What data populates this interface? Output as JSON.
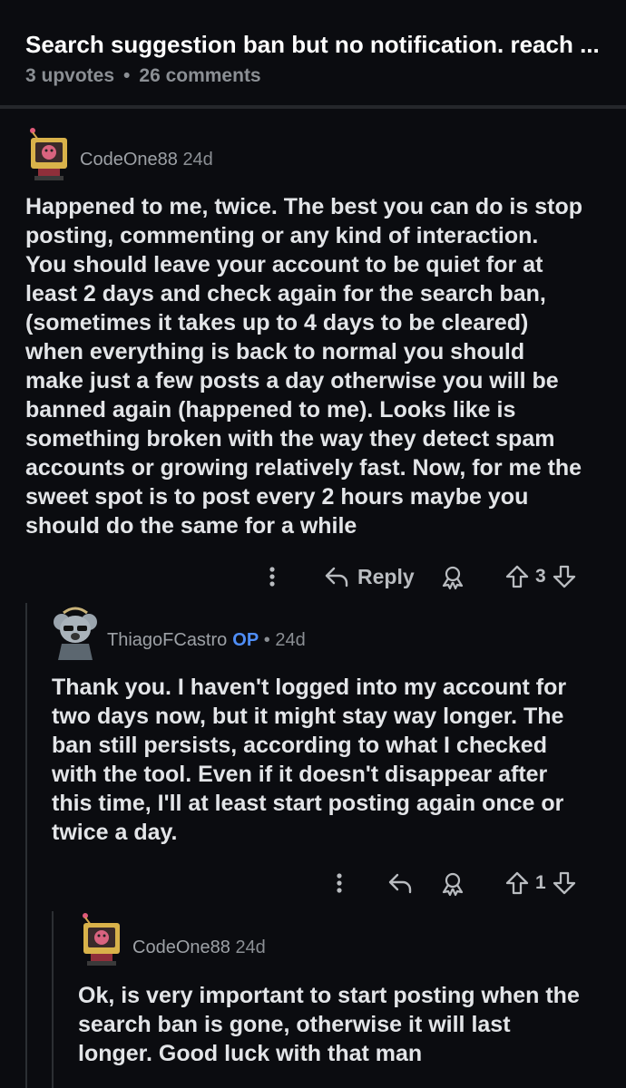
{
  "post": {
    "title": "Search suggestion ban but no notification. reach ...",
    "upvotes": "3 upvotes",
    "separator": "•",
    "comments": "26 comments"
  },
  "comments": [
    {
      "author": "CodeOne88",
      "age": "24d",
      "lines": [
        "Happened to me, twice. The best you can do is stop",
        "posting, commenting or any kind of interaction.",
        "You should leave your account to be quiet for at",
        "least 2 days and check again for the search ban,",
        "(sometimes it takes up to 4 days to be cleared)",
        "when everything is back to normal you should",
        "make just a few posts a day otherwise you will be",
        "banned again (happened to me). Looks like is",
        "something broken with the way they detect spam",
        "accounts or growing relatively fast. Now, for me the",
        "sweet spot is to post every 2 hours maybe you",
        "should do the same for a while"
      ],
      "reply_label": "Reply",
      "votes": "3"
    },
    {
      "author": "ThiagoFCastro",
      "op_badge": "OP",
      "age_sep": "•",
      "age": "24d",
      "lines": [
        "Thank you. I haven't logged into my account for",
        "two days now, but it might stay way longer. The",
        "ban still persists, according to what I checked",
        "with the tool. Even if it doesn't disappear after",
        "this time, I'll at least start posting again once or",
        "twice a day."
      ],
      "votes": "1"
    },
    {
      "author": "CodeOne88",
      "age": "24d",
      "lines": [
        "Ok, is very important to start posting when the",
        "search ban is gone, otherwise it will last",
        "longer. Good luck with that man"
      ]
    }
  ],
  "icons": {
    "more": "more-options-icon",
    "reply": "reply-arrow-icon",
    "award": "award-icon",
    "upvote": "upvote-arrow-icon",
    "downvote": "downvote-arrow-icon"
  }
}
